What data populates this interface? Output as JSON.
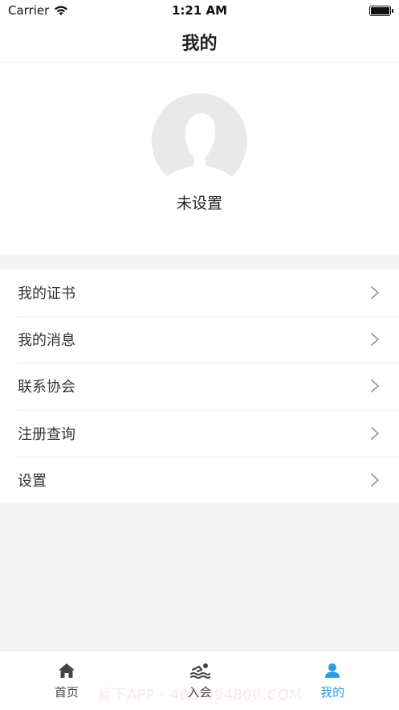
{
  "status_bar": {
    "carrier": "Carrier",
    "time": "1:21 AM"
  },
  "nav": {
    "title": "我的"
  },
  "profile": {
    "name": "未设置"
  },
  "menu": {
    "items": [
      {
        "label": "我的证书",
        "icon": "chevron-right-icon"
      },
      {
        "label": "我的消息",
        "icon": "chevron-right-icon"
      },
      {
        "label": "联系协会",
        "icon": "chevron-right-icon"
      },
      {
        "label": "注册查询",
        "icon": "chevron-right-icon"
      },
      {
        "label": "设置",
        "icon": "chevron-right-icon"
      }
    ]
  },
  "tabbar": {
    "tabs": [
      {
        "label": "首页",
        "icon": "home-icon"
      },
      {
        "label": "入会",
        "icon": "swimmer-icon"
      },
      {
        "label": "我的",
        "icon": "user-icon"
      }
    ],
    "active_color": "#2e9be6",
    "inactive_color": "#444444"
  },
  "watermark": "易下APP · 400-994800.COM"
}
